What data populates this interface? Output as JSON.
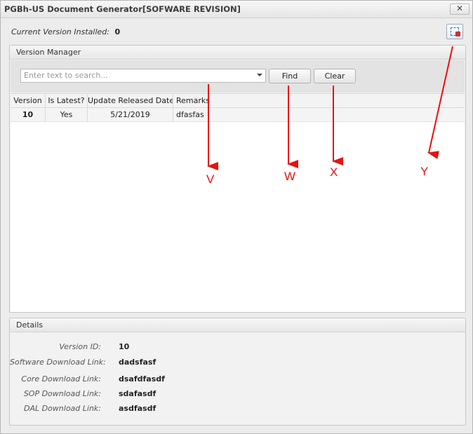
{
  "window": {
    "title": "PGBh-US Document Generator[SOFWARE REVISION]",
    "close_glyph": "✕"
  },
  "current_version": {
    "label": "Current Version Installed:",
    "value": "0"
  },
  "version_manager": {
    "header": "Version Manager",
    "search": {
      "placeholder": "Enter text to search..."
    },
    "find_label": "Find",
    "clear_label": "Clear",
    "columns": [
      "Version",
      "Is Latest?",
      "Update Released Date",
      "Remarks"
    ],
    "rows": [
      {
        "version": "10",
        "is_latest": "Yes",
        "date": "5/21/2019",
        "remarks": "dfasfas"
      }
    ]
  },
  "details": {
    "header": "Details",
    "fields": [
      {
        "label": "Version ID:",
        "value": "10"
      },
      {
        "label": "Software Download Link:",
        "value": "dadsfasf"
      },
      {
        "label": "Core Download Link:",
        "value": "dsafdfasdf"
      },
      {
        "label": "SOP Download Link:",
        "value": "sdafasdf"
      },
      {
        "label": "DAL Download Link:",
        "value": "asdfasdf"
      }
    ]
  },
  "annotations": [
    "V",
    "W",
    "X",
    "Y"
  ],
  "colors": {
    "annotation": "#e81010"
  }
}
